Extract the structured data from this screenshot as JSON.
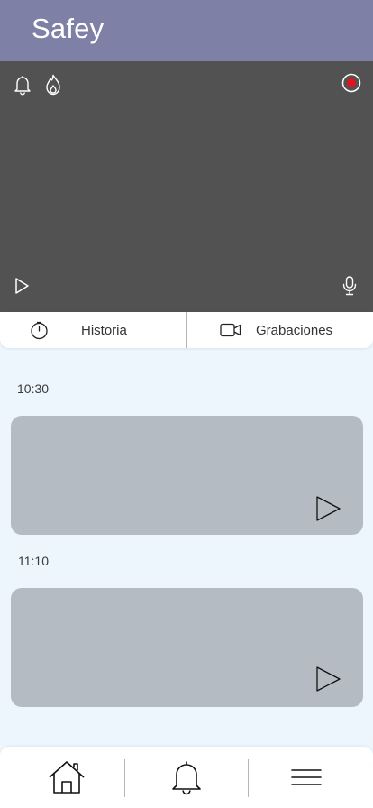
{
  "header": {
    "title": "Safey",
    "background": "#7E80A6"
  },
  "video": {
    "background": "#525252",
    "icons": [
      "bell-icon",
      "flame-icon",
      "record-icon",
      "play-icon",
      "microphone-icon"
    ],
    "record_color": "#E0141E"
  },
  "tabs": [
    {
      "label": "Historia",
      "icon": "clock-icon"
    },
    {
      "label": "Grabaciones",
      "icon": "video-camera-icon"
    }
  ],
  "recordings": [
    {
      "time": "10:30"
    },
    {
      "time": "11:10"
    }
  ],
  "bottom_nav": {
    "items": [
      "home-icon",
      "bell-icon",
      "menu-icon"
    ]
  },
  "colors": {
    "page_background": "#EDF6FD",
    "card_background": "#B4BBC2"
  }
}
